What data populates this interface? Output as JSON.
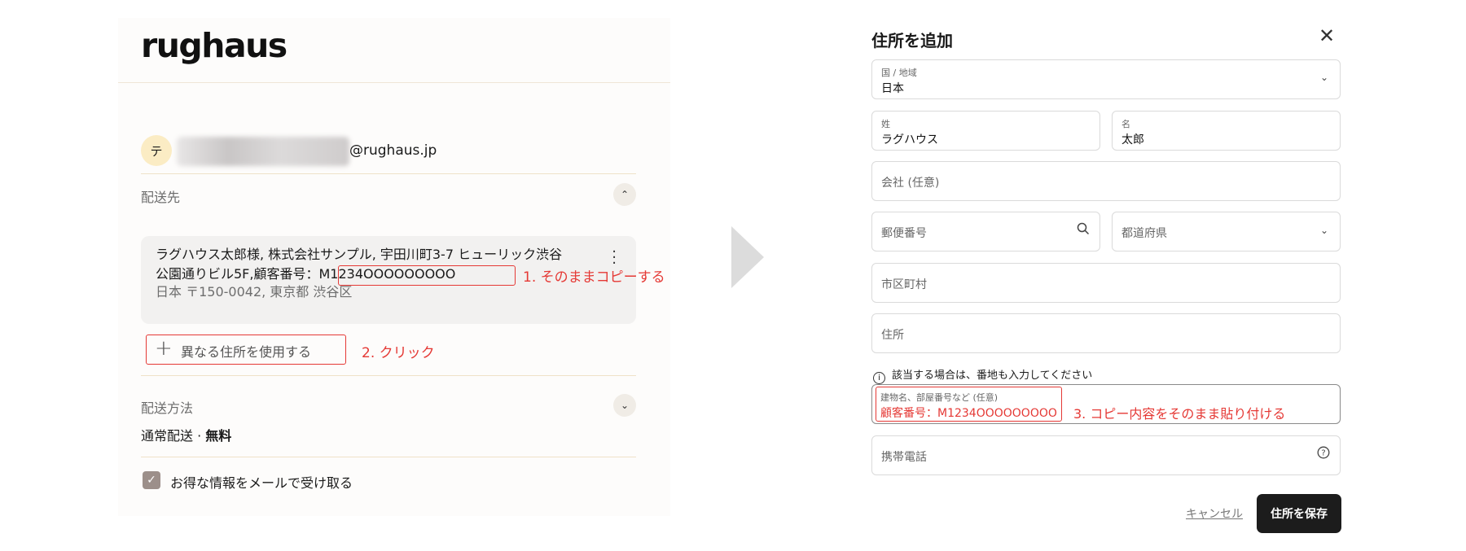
{
  "left": {
    "logo": "rughaus",
    "avatar_initial": "テ",
    "email_domain": "@rughaus.jp",
    "shipping_to_title": "配送先",
    "address": {
      "line1": "ラグハウス太郎様, 株式会社サンプル, 宇田川町3-7 ヒューリック渋谷",
      "line2_prefix": "公園通りビル5F,",
      "line2_customer": "顧客番号：M1234OOOOOOOOO",
      "line3": "日本 〒150-0042, 東京都 渋谷区"
    },
    "annotation_1": "1. そのままコピーする",
    "use_different_address": "異なる住所を使用する",
    "annotation_2": "2. クリック",
    "shipping_method_title": "配送方法",
    "shipping_method_value": "通常配送",
    "shipping_method_sep": " · ",
    "shipping_method_price": "無料",
    "newsletter_label": "お得な情報をメールで受け取る",
    "newsletter_checked": true
  },
  "modal": {
    "title": "住所を追加",
    "country": {
      "label": "国 / 地域",
      "value": "日本"
    },
    "last_name": {
      "label": "姓",
      "value": "ラグハウス"
    },
    "first_name": {
      "label": "名",
      "value": "太郎"
    },
    "company_placeholder": "会社 (任意)",
    "postal_placeholder": "郵便番号",
    "prefecture_placeholder": "都道府県",
    "city_placeholder": "市区町村",
    "address_placeholder": "住所",
    "hint": "該当する場合は、番地も入力してください",
    "building": {
      "label": "建物名、部屋番号など (任意)",
      "value": "顧客番号：M1234OOOOOOOOO"
    },
    "annotation_3": "3. コピー内容をそのまま貼り付ける",
    "phone_placeholder": "携帯電話",
    "cancel_label": "キャンセル",
    "save_label": "住所を保存"
  },
  "colors": {
    "annotation_red": "#e53935",
    "save_button": "#1c1c1c",
    "checkbox": "#9c8f8a",
    "avatar_bg": "#fbecc4"
  }
}
